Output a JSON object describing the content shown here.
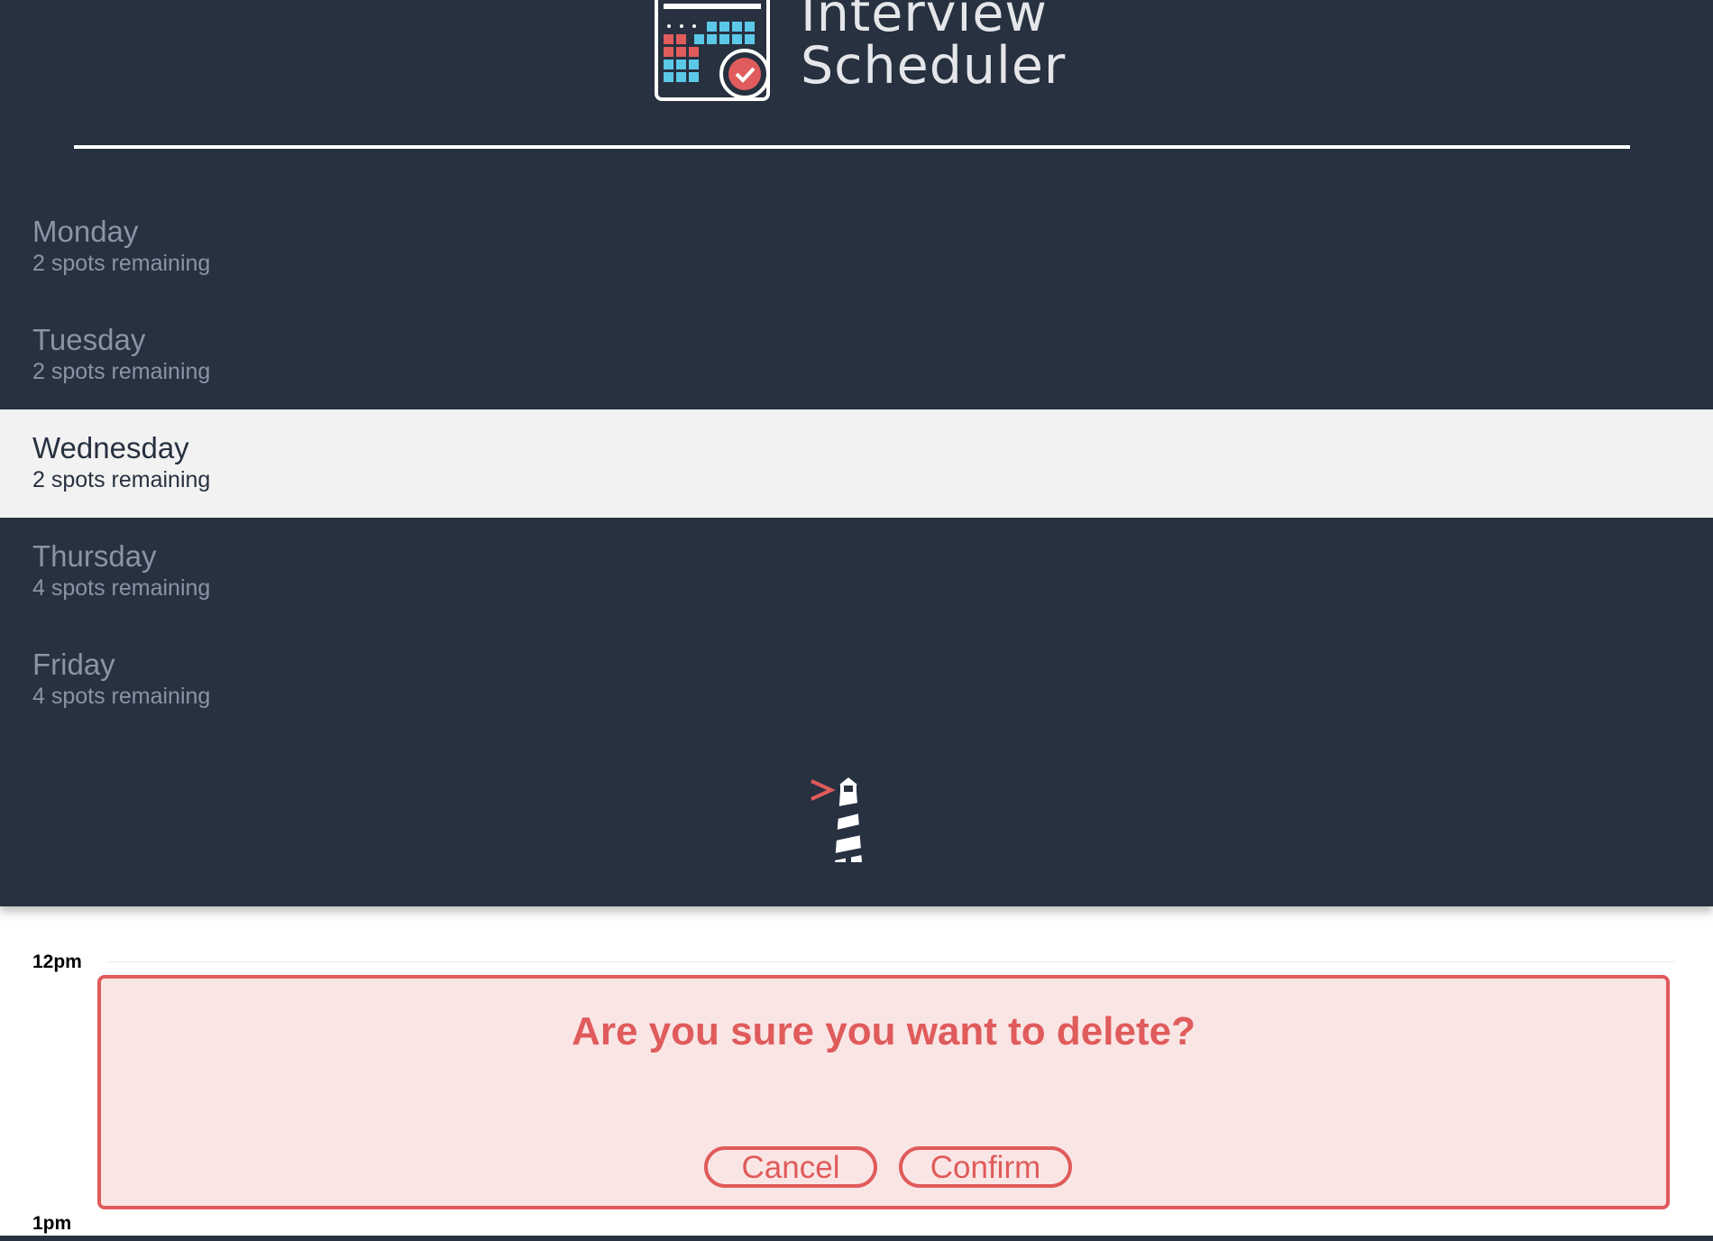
{
  "app": {
    "title_line1": "Interview",
    "title_line2": "Scheduler",
    "logo_icon": "calendar-check-icon",
    "footer_icon": "lighthouse-icon"
  },
  "days": [
    {
      "name": "Monday",
      "spots": "2 spots remaining",
      "selected": false
    },
    {
      "name": "Tuesday",
      "spots": "2 spots remaining",
      "selected": false
    },
    {
      "name": "Wednesday",
      "spots": "2 spots remaining",
      "selected": true
    },
    {
      "name": "Thursday",
      "spots": "4 spots remaining",
      "selected": false
    },
    {
      "name": "Friday",
      "spots": "4 spots remaining",
      "selected": false
    }
  ],
  "schedule": {
    "hours": [
      "12pm",
      "1pm"
    ],
    "confirm": {
      "message": "Are you sure you want to delete?",
      "cancel_label": "Cancel",
      "confirm_label": "Confirm"
    }
  },
  "colors": {
    "sidebar_bg": "#273140",
    "selected_bg": "#f2f2f2",
    "danger": "#e05b5b",
    "danger_bg": "#fae5e5"
  }
}
